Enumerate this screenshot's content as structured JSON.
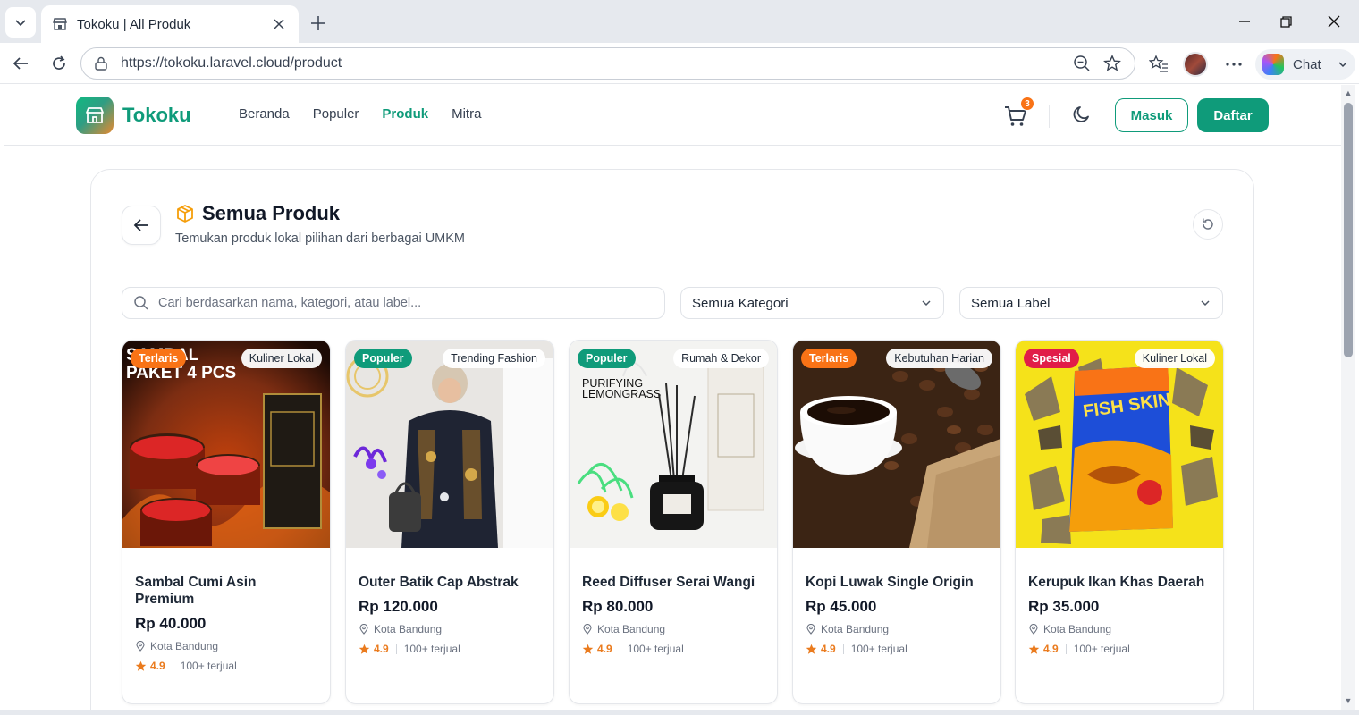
{
  "browser": {
    "tab_title": "Tokoku | All Produk",
    "url": "https://tokoku.laravel.cloud/product",
    "chat_label": "Chat"
  },
  "site": {
    "brand": "Tokoku",
    "nav": [
      {
        "label": "Beranda",
        "active": false
      },
      {
        "label": "Populer",
        "active": false
      },
      {
        "label": "Produk",
        "active": true
      },
      {
        "label": "Mitra",
        "active": false
      }
    ],
    "cart_count": "3",
    "login_label": "Masuk",
    "register_label": "Daftar"
  },
  "page": {
    "title": "Semua Produk",
    "subtitle": "Temukan produk lokal pilihan dari berbagai UMKM",
    "search_placeholder": "Cari berdasarkan nama, kategori, atau label...",
    "category_filter": "Semua Kategori",
    "label_filter": "Semua Label"
  },
  "colors": {
    "brand": "#0f9b7a",
    "badge_terlaris": "#f97316",
    "badge_populer": "#0f9b7a",
    "badge_spesial": "#e11d48",
    "rating": "#ea7b1e"
  },
  "products": [
    {
      "name": "Sambal Cumi Asin Premium",
      "price": "Rp 40.000",
      "location": "Kota Bandung",
      "rating": "4.9",
      "sold": "100+ terjual",
      "badge": "Terlaris",
      "badge_color": "#f97316",
      "category": "Kuliner Lokal",
      "image_text": "SAMBAL PAKET 4 PCS"
    },
    {
      "name": "Outer Batik Cap Abstrak",
      "price": "Rp 120.000",
      "location": "Kota Bandung",
      "rating": "4.9",
      "sold": "100+ terjual",
      "badge": "Populer",
      "badge_color": "#0f9b7a",
      "category": "Trending Fashion"
    },
    {
      "name": "Reed Diffuser Serai Wangi",
      "price": "Rp 80.000",
      "location": "Kota Bandung",
      "rating": "4.9",
      "sold": "100+ terjual",
      "badge": "Populer",
      "badge_color": "#0f9b7a",
      "category": "Rumah & Dekor",
      "image_text": "PURIFYING LEMONGRASS"
    },
    {
      "name": "Kopi Luwak Single Origin",
      "price": "Rp 45.000",
      "location": "Kota Bandung",
      "rating": "4.9",
      "sold": "100+ terjual",
      "badge": "Terlaris",
      "badge_color": "#f97316",
      "category": "Kebutuhan Harian"
    },
    {
      "name": "Kerupuk Ikan Khas Daerah",
      "price": "Rp 35.000",
      "location": "Kota Bandung",
      "rating": "4.9",
      "sold": "100+ terjual",
      "badge": "Spesial",
      "badge_color": "#e11d48",
      "category": "Kuliner Lokal",
      "image_text": "FISH SKIN"
    }
  ]
}
